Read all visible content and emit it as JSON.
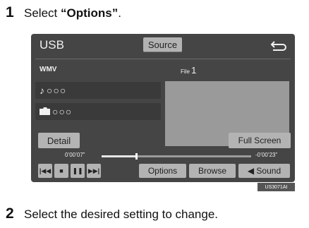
{
  "step1": {
    "number": "1",
    "prefix": "Select ",
    "highlight": "“Options”",
    "suffix": "."
  },
  "screen": {
    "source_title": "USB",
    "source_button": "Source",
    "format": "WMV",
    "file_label": "File",
    "file_number": "1",
    "track_title": "○○○",
    "folder_title": "○○○",
    "detail_button": "Detail",
    "fullscreen_button": "Full Screen",
    "time_elapsed": "0’00’07”",
    "time_remaining": "-0’00’23”",
    "progress_percent": 0.23,
    "controls": {
      "prev": "|◀◀",
      "stop": "■",
      "pause": "❚❚",
      "next": "▶▶|"
    },
    "options_button": "Options",
    "browse_button": "Browse",
    "sound_button": "◀ Sound"
  },
  "figure_code": "US3071AI",
  "step2": {
    "number": "2",
    "text": "Select the desired setting to change."
  }
}
